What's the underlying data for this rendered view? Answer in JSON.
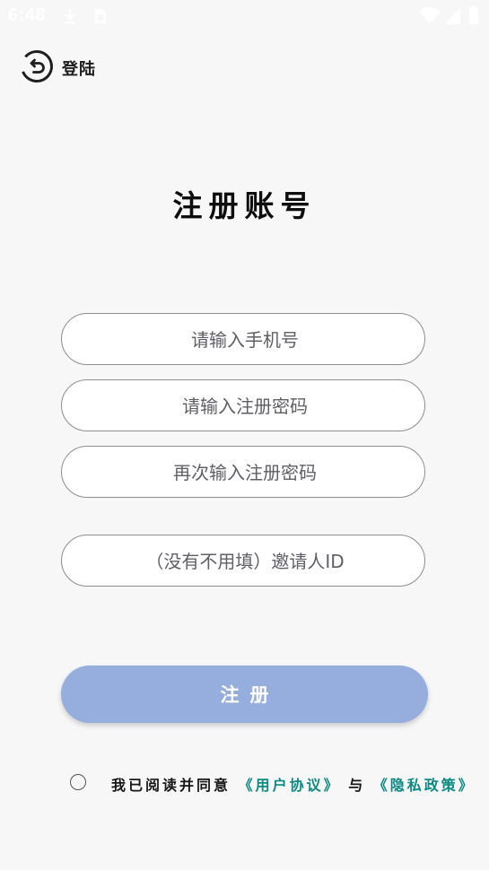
{
  "status_bar": {
    "time": "6:48",
    "icons": [
      "download-icon",
      "sim-card-icon",
      "wifi-icon",
      "signal-icon",
      "battery-icon"
    ]
  },
  "header": {
    "back_label": "登陆"
  },
  "page": {
    "title": "注册账号"
  },
  "form": {
    "phone_placeholder": "请输入手机号",
    "password_placeholder": "请输入注册密码",
    "confirm_password_placeholder": "再次输入注册密码",
    "inviter_placeholder": "（没有不用填）邀请人ID",
    "submit_label": "注册"
  },
  "agreement": {
    "prefix": "我已阅读并同意",
    "user_agreement": "《用户协议》",
    "conjunction": "与",
    "privacy_policy": "《隐私政策》"
  },
  "colors": {
    "background": "#f7f7f8",
    "button": "#95aedd",
    "link": "#0d8a82",
    "field_border": "#8d8d8d"
  }
}
